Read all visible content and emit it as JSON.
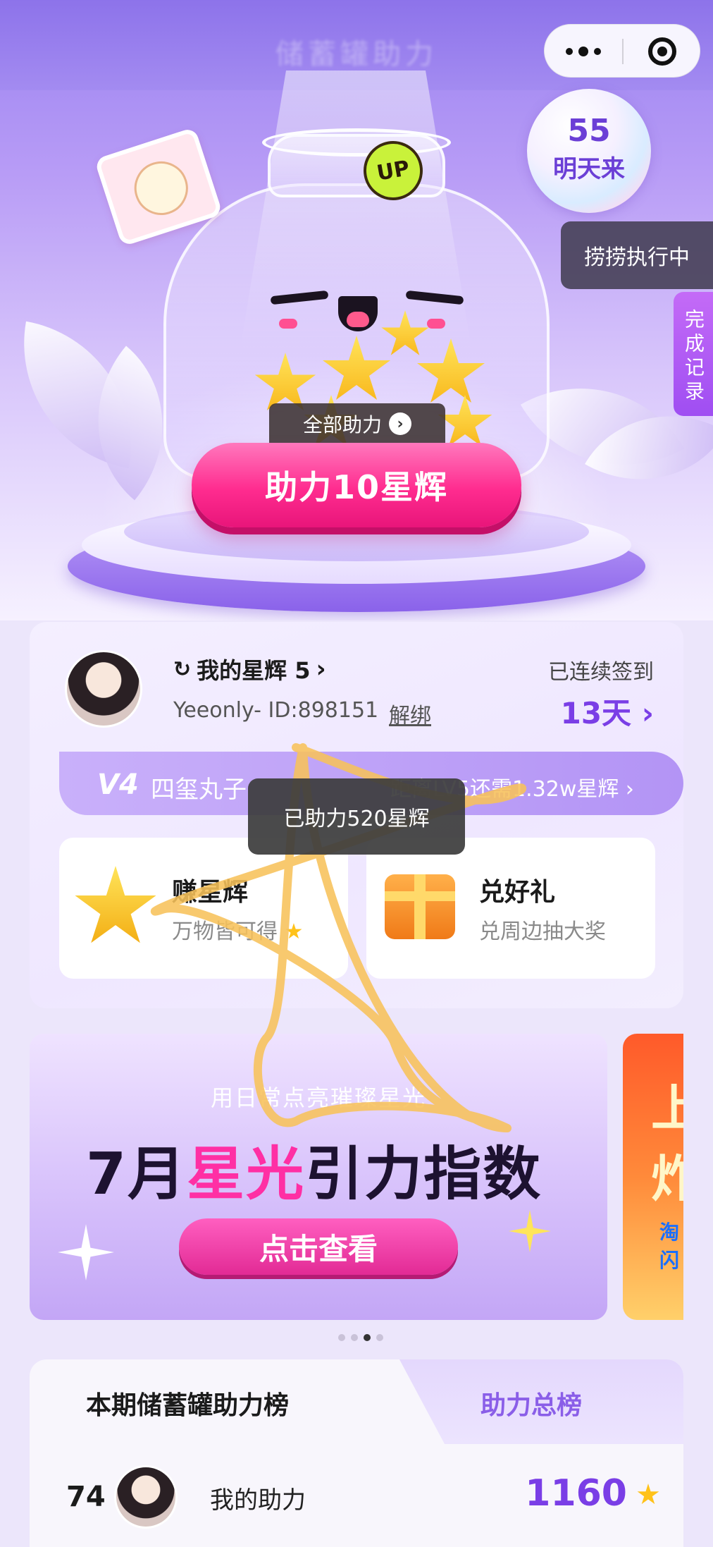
{
  "topbar": {
    "title": "储蓄罐助力",
    "more_icon": "more-dots-icon",
    "close_icon": "target-close-icon"
  },
  "hero": {
    "counter_value": "55",
    "counter_text": "明天来",
    "running_label": "捞捞执行中",
    "records_label": "完成记录",
    "up_badge": "UP",
    "all_help_label": "全部助力",
    "help_button_label": "助力10星辉"
  },
  "user": {
    "my_stars_label": "我的星辉 5",
    "id_text": "Yeeonly- ID:898151",
    "unbind_label": "解绑",
    "signed_label": "已连续签到",
    "signed_value": "13天",
    "level_badge": "V4",
    "level_name": "四玺丸子",
    "level_next": "距离LV5还需1.32w星辉",
    "toast": "已助力520星辉"
  },
  "cards": {
    "earn_title": "赚星辉",
    "earn_sub": "万物皆可得",
    "redeem_title": "兑好礼",
    "redeem_sub": "兑周边抽大奖"
  },
  "banner": {
    "subtitle": "用日常点亮璀璨星光",
    "title_part1": "7月",
    "title_part2": "星光",
    "title_part3": "引力指数",
    "button_label": "点击查看",
    "peek_chars": [
      "上",
      "炸",
      "淘",
      "闪"
    ]
  },
  "carousel": {
    "pages": 4,
    "active_index": 2
  },
  "ranking": {
    "tab_active": "本期储蓄罐助力榜",
    "tab_other": "助力总榜",
    "row": {
      "rank": "74",
      "name": "我的助力",
      "value": "1160"
    }
  },
  "colors": {
    "accent_purple": "#7a3ee6",
    "accent_pink": "#ff2c8f",
    "star_yellow": "#ffc21a"
  }
}
